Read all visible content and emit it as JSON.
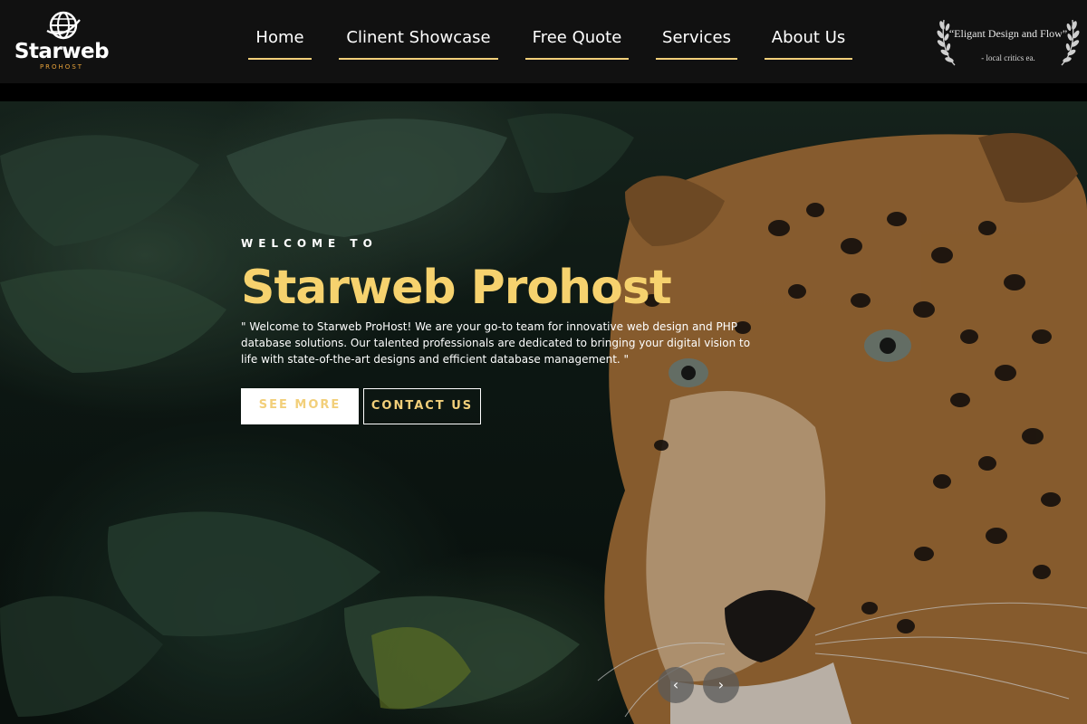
{
  "brand": {
    "name": "Starweb",
    "tagline": "PROHOST",
    "logo_icon": "globe-icon",
    "accent_color": "#f2cf7a",
    "logo_accent_color": "#e8a23a"
  },
  "nav": {
    "items": [
      {
        "label": "Home"
      },
      {
        "label": "Clinent Showcase"
      },
      {
        "label": "Free Quote"
      },
      {
        "label": "Services"
      },
      {
        "label": "About Us"
      }
    ]
  },
  "award": {
    "title": "“Eligant Design and Flow”",
    "source": "- local critics ea.",
    "icon": "laurel-wreath-icon"
  },
  "hero": {
    "eyebrow": "WELCOME TO",
    "title": "Starweb Prohost",
    "description": "\" Welcome to Starweb ProHost! We are your go-to team for innovative web design and PHP database solutions. Our talented professionals are dedicated to bringing your digital vision to life with state-of-the-art designs and efficient database management. \"",
    "title_color": "#f6d26e",
    "image_subject": "jaguar-in-jungle"
  },
  "cta": {
    "primary_label": "SEE MORE",
    "secondary_label": "CONTACT US"
  },
  "slider": {
    "prev_icon": "chevron-left-icon",
    "next_icon": "chevron-right-icon",
    "prev_glyph": "‹",
    "next_glyph": "›"
  }
}
